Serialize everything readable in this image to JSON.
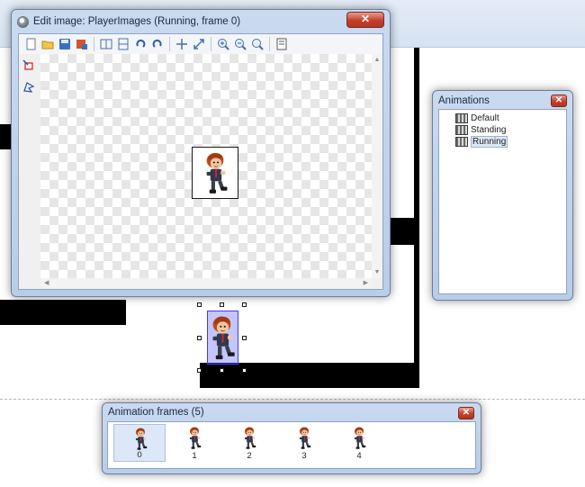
{
  "edit_window": {
    "title": "Edit image: PlayerImages (Running, frame 0)",
    "close_label": "✕",
    "toolbar": [
      {
        "icon": "new-document-icon"
      },
      {
        "icon": "open-folder-icon"
      },
      {
        "icon": "save-icon"
      },
      {
        "icon": "import-icon"
      },
      {
        "sep": true
      },
      {
        "icon": "flip-horizontal-icon"
      },
      {
        "icon": "flip-vertical-icon"
      },
      {
        "icon": "rotate-left-icon"
      },
      {
        "icon": "rotate-right-icon"
      },
      {
        "sep": true
      },
      {
        "icon": "move-icon"
      },
      {
        "icon": "resize-icon"
      },
      {
        "sep": true
      },
      {
        "icon": "zoom-in-icon"
      },
      {
        "icon": "zoom-out-icon"
      },
      {
        "icon": "zoom-reset-icon"
      },
      {
        "sep": true
      },
      {
        "icon": "properties-icon"
      }
    ],
    "side_tools": [
      {
        "icon": "set-origin-icon"
      },
      {
        "icon": "collision-mask-icon"
      }
    ]
  },
  "animations_panel": {
    "title": "Animations",
    "close_label": "✕",
    "items": [
      {
        "label": "Default",
        "selected": false
      },
      {
        "label": "Standing",
        "selected": false
      },
      {
        "label": "Running",
        "selected": true
      }
    ]
  },
  "frames_panel": {
    "title": "Animation frames (5)",
    "close_label": "✕",
    "frames": [
      {
        "number": "0",
        "selected": true
      },
      {
        "number": "1",
        "selected": false
      },
      {
        "number": "2",
        "selected": false
      },
      {
        "number": "3",
        "selected": false
      },
      {
        "number": "4",
        "selected": false
      }
    ]
  },
  "colors": {
    "window_frame": "#c9daf0",
    "close_button": "#c2402b",
    "selection_box": "#3b3bff"
  }
}
